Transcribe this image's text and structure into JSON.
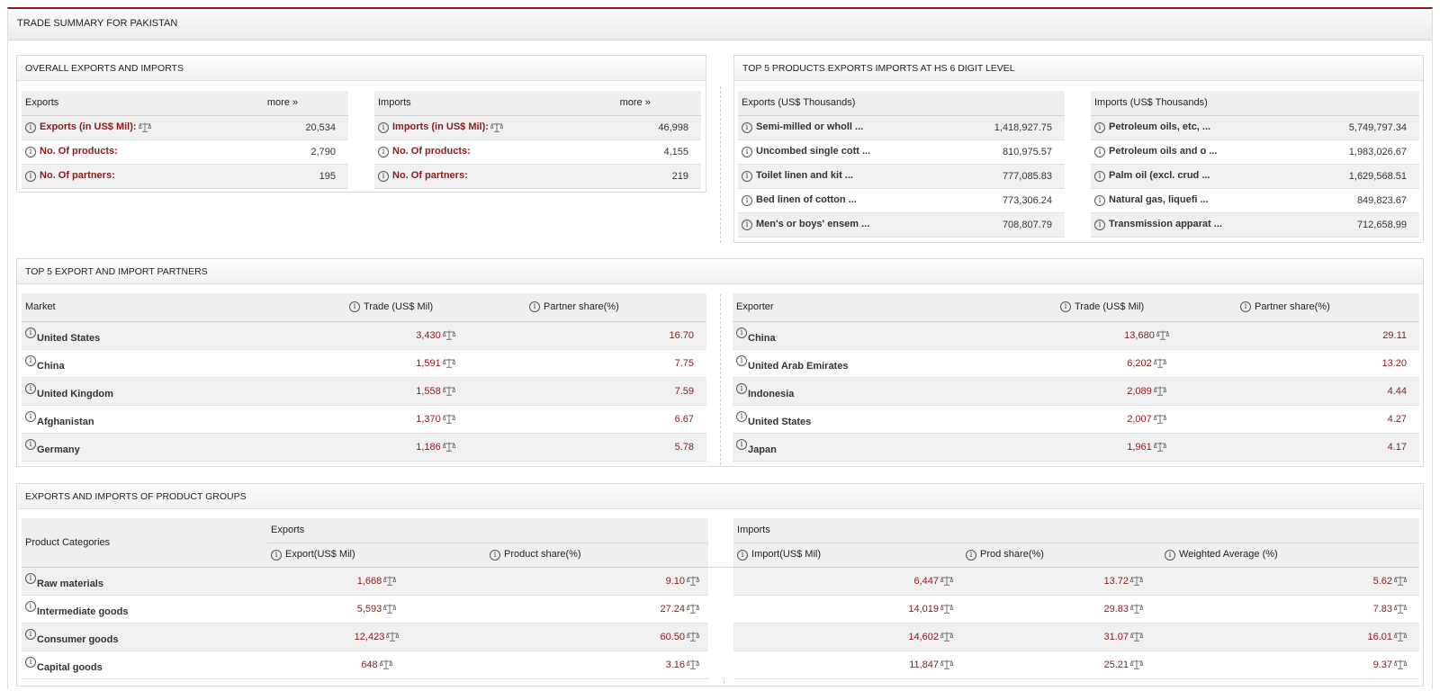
{
  "page_title": "TRADE SUMMARY FOR PAKISTAN",
  "overall": {
    "title": "OVERALL EXPORTS AND IMPORTS",
    "exports": {
      "header": "Exports",
      "more": "more »",
      "rows": [
        {
          "label": "Exports (in US$ Mil):",
          "value": "20,534",
          "scale": true
        },
        {
          "label": "No. Of products:",
          "value": "2,790"
        },
        {
          "label": "No. Of partners:",
          "value": "195"
        }
      ]
    },
    "imports": {
      "header": "Imports",
      "more": "more »",
      "rows": [
        {
          "label": "Imports (in US$ Mil):",
          "value": "46,998",
          "scale": true
        },
        {
          "label": "No. Of products:",
          "value": "4,155"
        },
        {
          "label": "No. Of partners:",
          "value": "219"
        }
      ]
    }
  },
  "top5_products": {
    "title": "TOP 5 PRODUCTS EXPORTS IMPORTS AT HS 6 DIGIT LEVEL",
    "exports": {
      "header": "Exports (US$ Thousands)",
      "rows": [
        {
          "label": "Semi-milled or wholl ...",
          "value": "1,418,927.75"
        },
        {
          "label": "Uncombed single cott ...",
          "value": "810,975.57"
        },
        {
          "label": "Toilet linen and kit ...",
          "value": "777,085.83"
        },
        {
          "label": "Bed linen of cotton ...",
          "value": "773,306.24"
        },
        {
          "label": "Men's or boys' ensem ...",
          "value": "708,807.79"
        }
      ]
    },
    "imports": {
      "header": "Imports (US$ Thousands)",
      "rows": [
        {
          "label": "Petroleum oils, etc, ...",
          "value": "5,749,797.34"
        },
        {
          "label": "Petroleum oils and o ...",
          "value": "1,983,026.67"
        },
        {
          "label": "Palm oil (excl. crud ...",
          "value": "1,629,568.51"
        },
        {
          "label": "Natural gas, liquefi ...",
          "value": "849,823.67"
        },
        {
          "label": "Transmission apparat ...",
          "value": "712,658.99"
        }
      ]
    }
  },
  "partners": {
    "title": "TOP 5 EXPORT AND IMPORT PARTNERS",
    "exports": {
      "col1": "Market",
      "col2": "Trade (US$ Mil)",
      "col3": "Partner share(%)",
      "rows": [
        {
          "name": "United States",
          "trade": "3,430",
          "share": "16.70"
        },
        {
          "name": "China",
          "trade": "1,591",
          "share": "7.75"
        },
        {
          "name": "United Kingdom",
          "trade": "1,558",
          "share": "7.59"
        },
        {
          "name": "Afghanistan",
          "trade": "1,370",
          "share": "6.67"
        },
        {
          "name": "Germany",
          "trade": "1,186",
          "share": "5.78"
        }
      ]
    },
    "imports": {
      "col1": "Exporter",
      "col2": "Trade (US$ Mil)",
      "col3": "Partner share(%)",
      "rows": [
        {
          "name": "China",
          "trade": "13,680",
          "share": "29.11"
        },
        {
          "name": "United Arab Emirates",
          "trade": "6,202",
          "share": "13.20"
        },
        {
          "name": "Indonesia",
          "trade": "2,089",
          "share": "4.44"
        },
        {
          "name": "United States",
          "trade": "2,007",
          "share": "4.27"
        },
        {
          "name": "Japan",
          "trade": "1,961",
          "share": "4.17"
        }
      ]
    }
  },
  "groups": {
    "title": "EXPORTS AND IMPORTS OF PRODUCT GROUPS",
    "cat_header": "Product Categories",
    "exports_header": "Exports",
    "imports_header": "Imports",
    "export_col": "Export(US$ Mil)",
    "product_share_col": "Product share(%)",
    "import_col": "Import(US$ Mil)",
    "prod_share_col": "Prod share(%)",
    "weighted_col": "Weighted Average (%)",
    "rows": [
      {
        "name": "Raw materials",
        "export": "1,668",
        "pshare": "9.10",
        "import": "6,447",
        "ishare": "13.72",
        "wavg": "5.62"
      },
      {
        "name": "Intermediate goods",
        "export": "5,593",
        "pshare": "27.24",
        "import": "14,019",
        "ishare": "29.83",
        "wavg": "7.83"
      },
      {
        "name": "Consumer goods",
        "export": "12,423",
        "pshare": "60.50",
        "import": "14,602",
        "ishare": "31.07",
        "wavg": "16.01"
      },
      {
        "name": "Capital goods",
        "export": "648",
        "pshare": "3.16",
        "import": "11,847",
        "ishare": "25.21",
        "wavg": "9.37"
      }
    ]
  }
}
